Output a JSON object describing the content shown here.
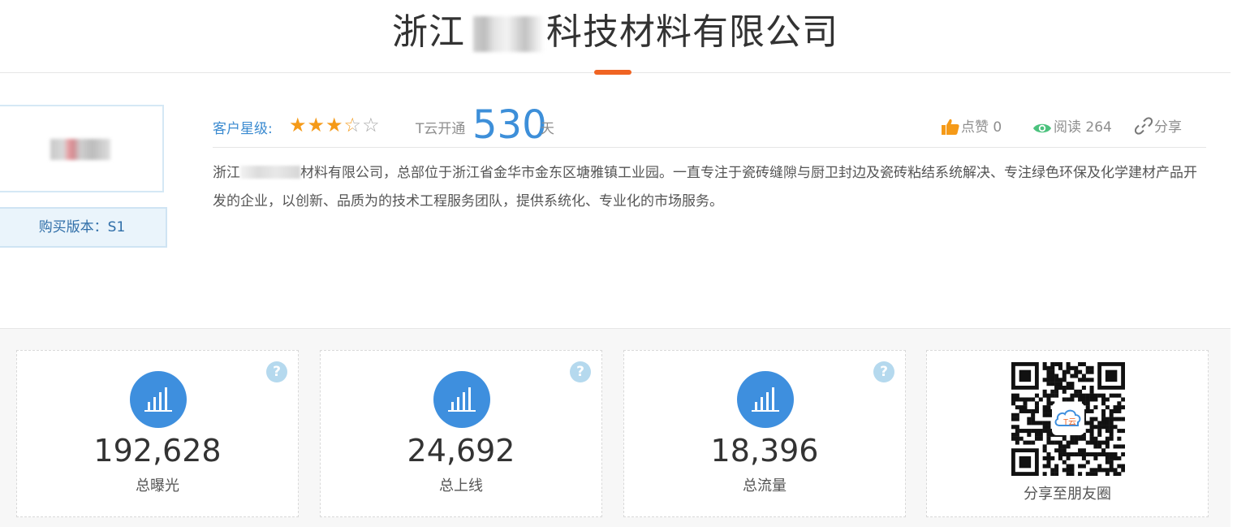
{
  "header": {
    "title_prefix": "浙江",
    "title_suffix": "科技材料有限公司"
  },
  "profile": {
    "version_label": "购买版本：S1"
  },
  "rating": {
    "label": "客户星级:",
    "stars": 3.5,
    "max_stars": 5,
    "star_color": "#f59a18"
  },
  "cloud": {
    "label": "T云开通",
    "days": "530",
    "unit": "天"
  },
  "actions": {
    "like": "点赞 0",
    "read": "阅读 264",
    "share": "分享"
  },
  "description": {
    "prefix": "浙江",
    "suffix": "材料有限公司，总部位于浙江省金华市金东区塘雅镇工业园。一直专注于瓷砖缝隙与厨卫封边及瓷砖粘结系统解决、专注绿色环保及化学建材产品开发的企业，以创新、品质为的技术工程服务团队，提供系统化、专业化的市场服务。"
  },
  "stats": [
    {
      "value": "192,628",
      "label": "总曝光"
    },
    {
      "value": "24,692",
      "label": "总上线"
    },
    {
      "value": "18,396",
      "label": "总流量"
    }
  ],
  "qr": {
    "label": "分享至朋友圈",
    "logo_text": "T云"
  },
  "colors": {
    "accent_orange": "#f06423",
    "primary_blue": "#3e8fde",
    "help_blue": "#b5d9ee"
  }
}
